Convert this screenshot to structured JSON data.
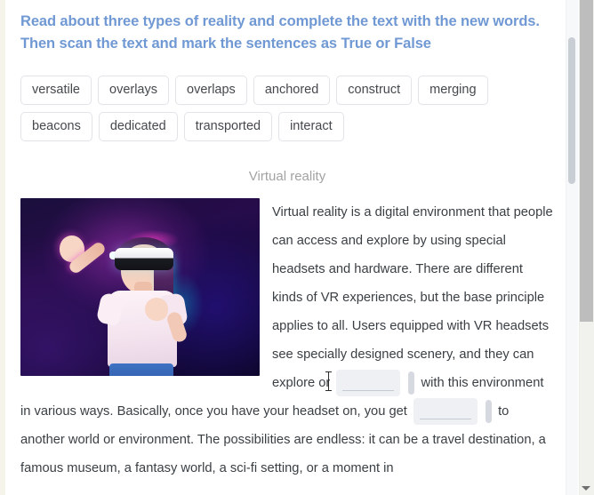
{
  "exercise": {
    "instruction": "Read about three types of reality and complete the text with the new words. Then scan the text and mark the sentences as True or False",
    "heading_color": "#7099d4",
    "word_bank": [
      {
        "label": "versatile"
      },
      {
        "label": "overlays"
      },
      {
        "label": "overlaps"
      },
      {
        "label": "anchored"
      },
      {
        "label": "construct"
      },
      {
        "label": "merging"
      },
      {
        "label": "beacons"
      },
      {
        "label": "dedicated"
      },
      {
        "label": "transported"
      },
      {
        "label": "interact"
      }
    ],
    "section": {
      "title": "Virtual reality",
      "image_alt": "child-wearing-vr-headset-photo"
    },
    "passage": {
      "part1": "Virtual reality is a digital environment that people can access and explore by using special headsets and hardware. There are different kinds of VR experiences, but the base principle applies to all. Users equipped with VR headsets see specially designed scenery, and they can explore or",
      "blank1_value": "",
      "part2": "with this environment in various ways. Basically, once you have your headset on, you get",
      "blank2_value": "",
      "part3": "to another world or environment. The possibilities are endless: it can be a travel destination, a famous museum, a fantasy world, a sci-fi setting, or a moment in"
    }
  },
  "scrollbars": {
    "inner_label": "inner-panel-scrollbar",
    "outer_label": "page-scrollbar"
  }
}
